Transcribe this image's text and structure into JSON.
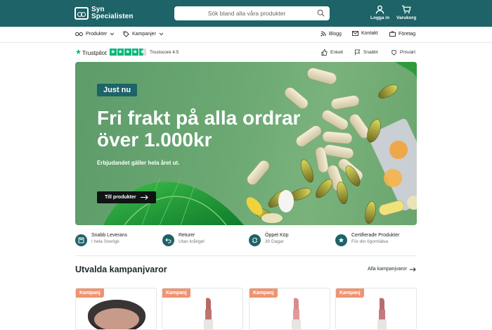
{
  "brand": {
    "line1": "Syn",
    "line2": "Specialisten"
  },
  "search": {
    "placeholder": "Sök bland alla våra produkter"
  },
  "header": {
    "login_label": "Logga in",
    "cart_label": "Varukorg"
  },
  "subnav": {
    "products_label": "Produkter",
    "campaigns_label": "Kampanjer",
    "blog_label": "Blogg",
    "contact_label": "Kontakt",
    "business_label": "Företag"
  },
  "trust": {
    "brand": "Trustpilot",
    "score_text": "Trustscore 4.5",
    "rating": 4.5,
    "usps": [
      "Enkelt",
      "Snabbt",
      "Prisvärt"
    ]
  },
  "hero": {
    "badge": "Just nu",
    "title": "Fri frakt på alla ordrar över 1.000kr",
    "subtitle": "Erbjudandet gäller hela året ut.",
    "button_label": "Till produkter"
  },
  "usps": [
    {
      "title": "Snabb Leverans",
      "sub": "I hela Sverige"
    },
    {
      "title": "Returer",
      "sub": "Utan krångel"
    },
    {
      "title": "Öppet Köp",
      "sub": "30 Dagar"
    },
    {
      "title": "Certifierade Produkter",
      "sub": "För din ögonhälsa"
    }
  ],
  "campaign_section": {
    "title": "Utvalda kampanjvaror",
    "link_label": "Alla kampanjvaror"
  },
  "products": [
    {
      "badge": "Kampanj",
      "icon": "compact-powder"
    },
    {
      "badge": "Kampanj",
      "icon": "lipstick"
    },
    {
      "badge": "Kampanj",
      "icon": "lipstick"
    },
    {
      "badge": "Kampanj",
      "icon": "lipstick"
    }
  ],
  "colors": {
    "brand": "#1d6368",
    "hero_green": "#6ba872",
    "badge_orange": "#ef9472",
    "trustpilot": "#00b67a"
  }
}
